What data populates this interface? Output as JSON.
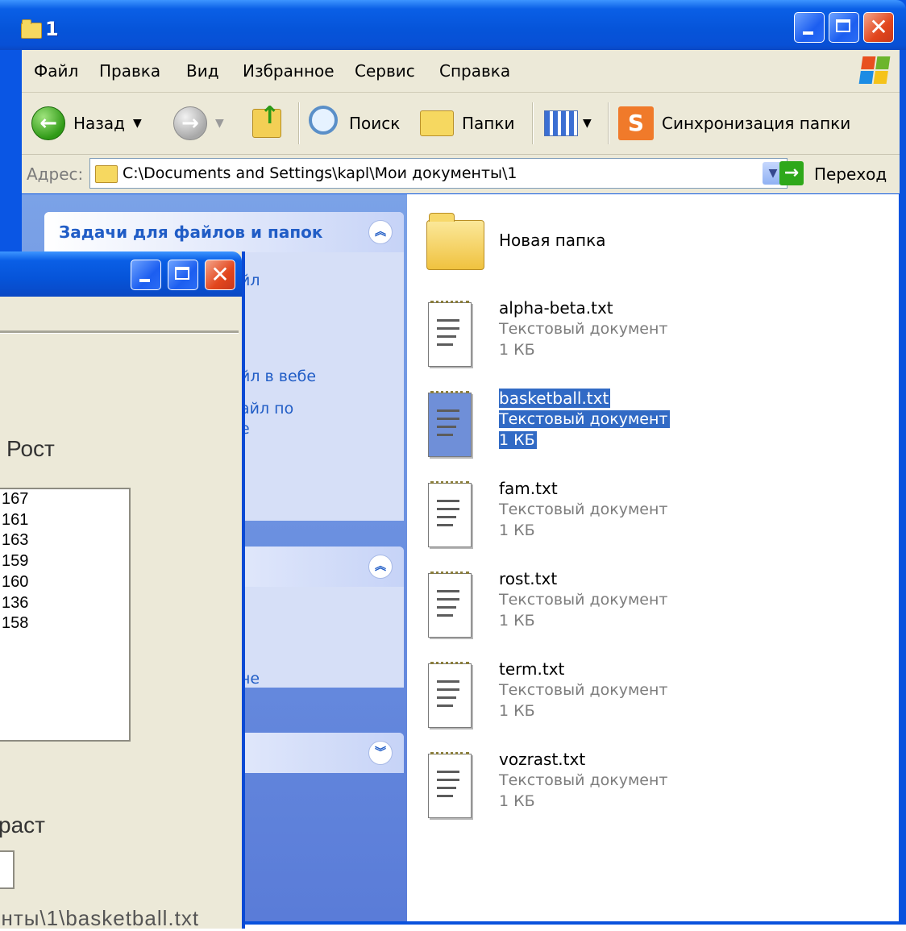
{
  "explorer": {
    "title": "1",
    "menu": [
      "Файл",
      "Правка",
      "Вид",
      "Избранное",
      "Сервис",
      "Справка"
    ],
    "toolbar": {
      "back": "Назад",
      "search": "Поиск",
      "folders": "Папки",
      "sync": "Синхронизация папки"
    },
    "address": {
      "label": "Адрес:",
      "value": "C:\\Documents and Settings\\kapl\\Мои документы\\1",
      "go": "Переход"
    },
    "taskpane": {
      "section1_title": "Задачи для файлов и папок",
      "link_fragments": [
        "йл",
        "йл в вебе",
        "айл по",
        "е"
      ],
      "section2_fragment": "не"
    },
    "files": [
      {
        "name": "Новая папка",
        "kind": "folder"
      },
      {
        "name": "alpha-beta.txt",
        "type": "Текстовый документ",
        "size": "1 КБ"
      },
      {
        "name": "basketball.txt",
        "type": "Текстовый документ",
        "size": "1 КБ",
        "selected": true
      },
      {
        "name": "fam.txt",
        "type": "Текстовый документ",
        "size": "1 КБ"
      },
      {
        "name": "rost.txt",
        "type": "Текстовый документ",
        "size": "1 КБ"
      },
      {
        "name": "term.txt",
        "type": "Текстовый документ",
        "size": "1 КБ"
      },
      {
        "name": "vozrast.txt",
        "type": "Текстовый документ",
        "size": "1 КБ"
      }
    ]
  },
  "app": {
    "label_rost": "Рост",
    "heights": [
      "167",
      "161",
      "163",
      "159",
      "160",
      "136",
      "158"
    ],
    "label_vozrast_fragment": "раст",
    "path_fragment": "енты\\1\\basketball.txt"
  },
  "colors": {
    "xp_blue": "#0a56e4",
    "selection": "#316ac5",
    "link": "#215dc6"
  }
}
